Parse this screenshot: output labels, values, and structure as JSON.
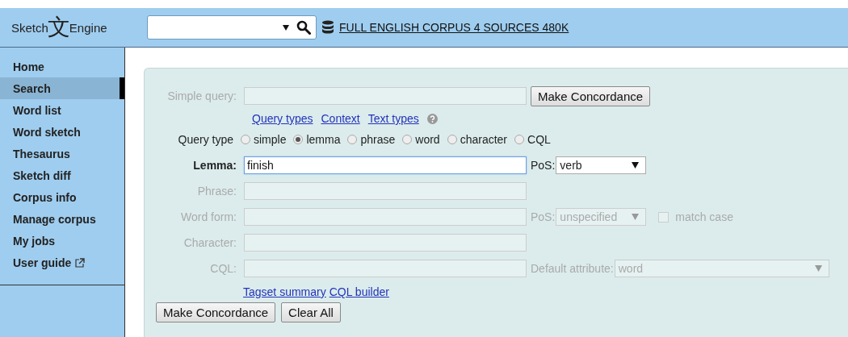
{
  "header": {
    "logo": {
      "left": "Sketch",
      "glyph": "文",
      "right": "Engine"
    },
    "corpus_link": "FULL ENGLISH CORPUS 4 SOURCES 480K"
  },
  "sidebar": {
    "items": [
      {
        "label": "Home",
        "selected": false,
        "external": false
      },
      {
        "label": "Search",
        "selected": true,
        "external": false
      },
      {
        "label": "Word list",
        "selected": false,
        "external": false
      },
      {
        "label": "Word sketch",
        "selected": false,
        "external": false
      },
      {
        "label": "Thesaurus",
        "selected": false,
        "external": false
      },
      {
        "label": "Sketch diff",
        "selected": false,
        "external": false
      },
      {
        "label": "Corpus info",
        "selected": false,
        "external": false
      },
      {
        "label": "Manage corpus",
        "selected": false,
        "external": false
      },
      {
        "label": "My jobs",
        "selected": false,
        "external": false
      },
      {
        "label": "User guide",
        "selected": false,
        "external": true
      }
    ]
  },
  "form": {
    "simple_query": {
      "label": "Simple query:",
      "disabled": true,
      "button": "Make Concordance"
    },
    "links": [
      "Query types",
      "Context",
      "Text types"
    ],
    "query_type": {
      "label": "Query type",
      "options": [
        {
          "label": "simple",
          "selected": false
        },
        {
          "label": "lemma",
          "selected": true
        },
        {
          "label": "phrase",
          "selected": false
        },
        {
          "label": "word",
          "selected": false
        },
        {
          "label": "character",
          "selected": false
        },
        {
          "label": "CQL",
          "selected": false
        }
      ]
    },
    "rows": [
      {
        "label": "Lemma:",
        "value": "finish",
        "disabled": false,
        "focused": true,
        "select": {
          "kind": "pos",
          "label": "PoS:",
          "value": "verb",
          "disabled": false
        }
      },
      {
        "label": "Phrase:",
        "disabled": true,
        "focused": false
      },
      {
        "label": "Word form:",
        "disabled": true,
        "focused": false,
        "select": {
          "kind": "pos",
          "label": "PoS:",
          "value": "unspecified",
          "disabled": true
        },
        "checkbox": {
          "label": "match case",
          "checked": false,
          "disabled": true
        }
      },
      {
        "label": "Character:",
        "disabled": true,
        "focused": false
      },
      {
        "label": "CQL:",
        "disabled": true,
        "focused": false,
        "select": {
          "kind": "attribute",
          "label": "Default attribute:",
          "value": "word",
          "disabled": true
        }
      }
    ],
    "tool_links": [
      "Tagset summary",
      "CQL builder"
    ],
    "buttons": [
      "Make Concordance",
      "Clear All"
    ]
  }
}
